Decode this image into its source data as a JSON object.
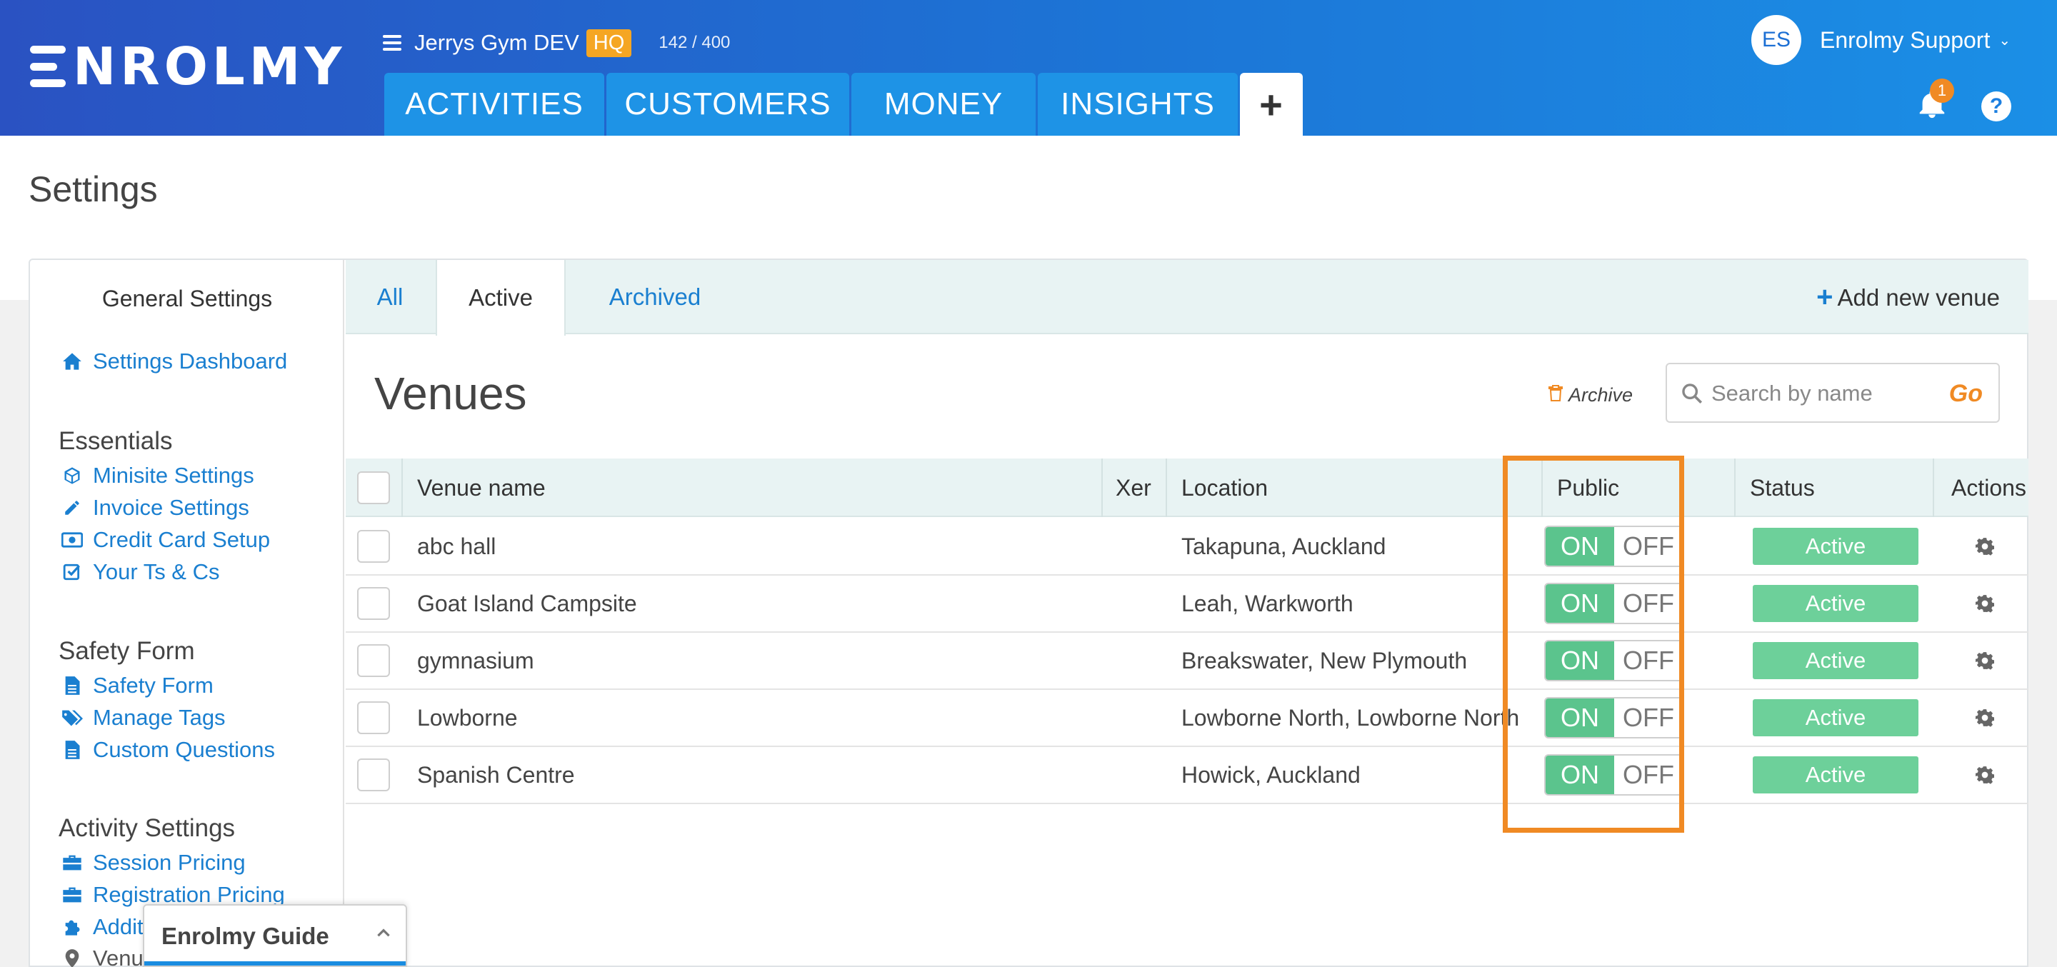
{
  "header": {
    "logo_text": "NROLMY",
    "org_name": "Jerrys Gym DEV",
    "org_badge": "HQ",
    "usage_count": "142 / 400",
    "nav_tabs": [
      {
        "label": "ACTIVITIES"
      },
      {
        "label": "CUSTOMERS"
      },
      {
        "label": "MONEY"
      },
      {
        "label": "INSIGHTS"
      }
    ],
    "user_initials": "ES",
    "user_name": "Enrolmy Support",
    "notification_count": "1",
    "help_label": "?"
  },
  "page": {
    "title": "Settings"
  },
  "sidebar": {
    "title": "General Settings",
    "dashboard_label": "Settings Dashboard",
    "essentials_heading": "Essentials",
    "essentials": [
      {
        "label": "Minisite Settings",
        "icon": "cube-icon"
      },
      {
        "label": "Invoice Settings",
        "icon": "pencil-icon"
      },
      {
        "label": "Credit Card Setup",
        "icon": "money-icon"
      },
      {
        "label": "Your Ts & Cs",
        "icon": "checkbox-icon"
      }
    ],
    "safety_heading": "Safety Form",
    "safety": [
      {
        "label": "Safety Form",
        "icon": "document-icon"
      },
      {
        "label": "Manage Tags",
        "icon": "tags-icon"
      },
      {
        "label": "Custom Questions",
        "icon": "document-icon"
      }
    ],
    "activity_heading": "Activity Settings",
    "activity": [
      {
        "label": "Session Pricing",
        "icon": "briefcase-icon"
      },
      {
        "label": "Registration Pricing",
        "icon": "briefcase-icon"
      },
      {
        "label": "Additi",
        "icon": "puzzle-icon"
      },
      {
        "label": "Venu",
        "icon": "map-marker-icon"
      }
    ]
  },
  "venues": {
    "tabs": [
      {
        "label": "All"
      },
      {
        "label": "Active"
      },
      {
        "label": "Archived"
      }
    ],
    "active_tab": "Active",
    "add_label": "Add new venue",
    "title": "Venues",
    "archive_label": "Archive",
    "search_placeholder": "Search by name",
    "search_go": "Go",
    "columns": {
      "name": "Venue name",
      "xero": "Xer",
      "location": "Location",
      "public": "Public",
      "status": "Status",
      "actions": "Actions"
    },
    "toggle_on": "ON",
    "toggle_off": "OFF",
    "rows": [
      {
        "name": "abc hall",
        "location": "Takapuna, Auckland",
        "status": "Active",
        "public": true
      },
      {
        "name": "Goat Island Campsite",
        "location": "Leah, Warkworth",
        "status": "Active",
        "public": true
      },
      {
        "name": "gymnasium",
        "location": "Breakswater, New Plymouth",
        "status": "Active",
        "public": true
      },
      {
        "name": "Lowborne",
        "location": "Lowborne North, Lowborne North",
        "status": "Active",
        "public": true
      },
      {
        "name": "Spanish Centre",
        "location": "Howick, Auckland",
        "status": "Active",
        "public": true
      }
    ]
  },
  "guide": {
    "label": "Enrolmy Guide"
  },
  "colors": {
    "header_start": "#2a52c2",
    "header_end": "#1b8fe6",
    "nav_tab": "#1e93e6",
    "link": "#1a7fd0",
    "toggle_on": "#5bc48d",
    "status_active": "#6dd09a",
    "highlight": "#f08a24",
    "hq_badge": "#f5a623"
  }
}
